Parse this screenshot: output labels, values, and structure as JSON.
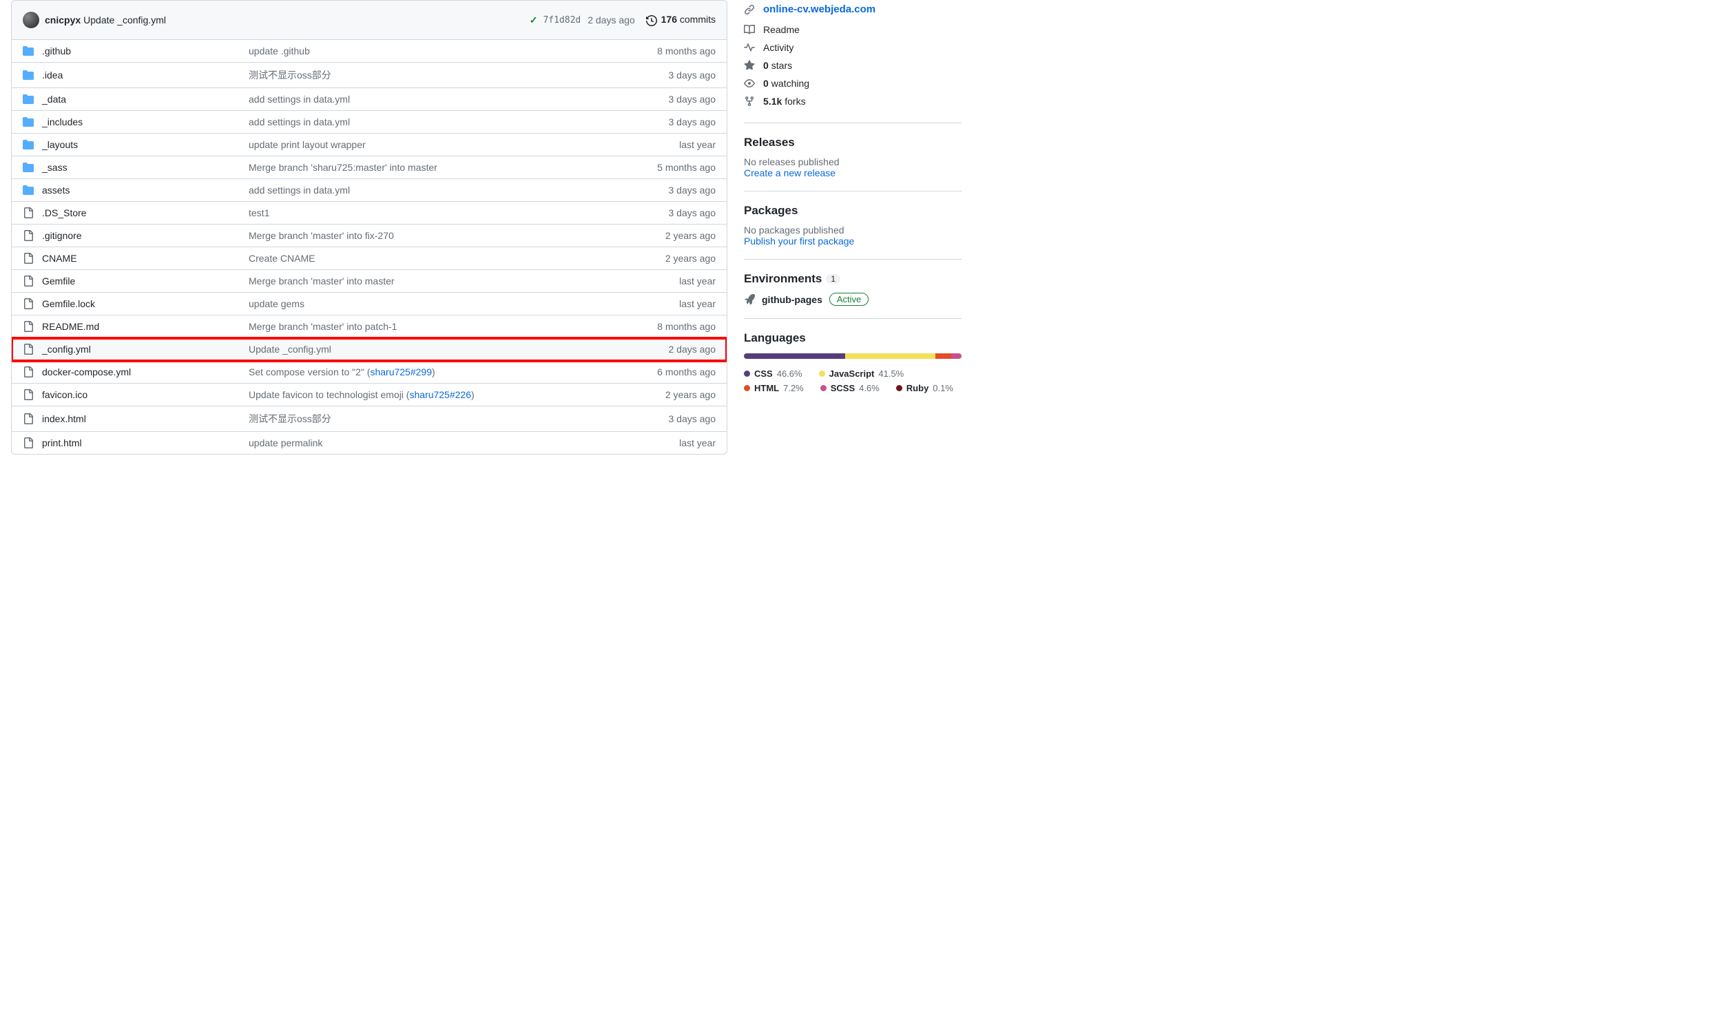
{
  "header": {
    "author": "cnicpyx",
    "commit_message": "Update _config.yml",
    "hash": "7f1d82d",
    "ago": "2 days ago",
    "commits_count": "176",
    "commits_label": "commits"
  },
  "files": [
    {
      "type": "folder",
      "name": ".github",
      "msg": "update .github",
      "ago": "8 months ago"
    },
    {
      "type": "folder",
      "name": ".idea",
      "msg": "测试不显示oss部分",
      "ago": "3 days ago"
    },
    {
      "type": "folder",
      "name": "_data",
      "msg": "add settings in data.yml",
      "ago": "3 days ago"
    },
    {
      "type": "folder",
      "name": "_includes",
      "msg": "add settings in data.yml",
      "ago": "3 days ago"
    },
    {
      "type": "folder",
      "name": "_layouts",
      "msg": "update print layout wrapper",
      "ago": "last year"
    },
    {
      "type": "folder",
      "name": "_sass",
      "msg": "Merge branch 'sharu725:master' into master",
      "ago": "5 months ago"
    },
    {
      "type": "folder",
      "name": "assets",
      "msg": "add settings in data.yml",
      "ago": "3 days ago"
    },
    {
      "type": "file",
      "name": ".DS_Store",
      "msg": "test1",
      "ago": "3 days ago"
    },
    {
      "type": "file",
      "name": ".gitignore",
      "msg": "Merge branch 'master' into fix-270",
      "ago": "2 years ago"
    },
    {
      "type": "file",
      "name": "CNAME",
      "msg": "Create CNAME",
      "ago": "2 years ago"
    },
    {
      "type": "file",
      "name": "Gemfile",
      "msg": "Merge branch 'master' into master",
      "ago": "last year"
    },
    {
      "type": "file",
      "name": "Gemfile.lock",
      "msg": "update gems",
      "ago": "last year"
    },
    {
      "type": "file",
      "name": "README.md",
      "msg": "Merge branch 'master' into patch-1",
      "ago": "8 months ago"
    },
    {
      "type": "file",
      "name": "_config.yml",
      "msg": "Update _config.yml",
      "ago": "2 days ago",
      "highlight": true
    },
    {
      "type": "file",
      "name": "docker-compose.yml",
      "msg_pre": "Set compose version to \"2\" (",
      "pr": "sharu725#299",
      "msg_post": ")",
      "ago": "6 months ago"
    },
    {
      "type": "file",
      "name": "favicon.ico",
      "msg_pre": "Update favicon to technologist emoji (",
      "pr": "sharu725#226",
      "msg_post": ")",
      "ago": "2 years ago"
    },
    {
      "type": "file",
      "name": "index.html",
      "msg": "测试不显示oss部分",
      "ago": "3 days ago"
    },
    {
      "type": "file",
      "name": "print.html",
      "msg": "update permalink",
      "ago": "last year"
    }
  ],
  "sidebar": {
    "website": "online-cv.webjeda.com",
    "readme": "Readme",
    "activity": "Activity",
    "stars_count": "0",
    "stars_label": "stars",
    "watch_count": "0",
    "watch_label": "watching",
    "forks_count": "5.1k",
    "forks_label": "forks",
    "releases": {
      "heading": "Releases",
      "none": "No releases published",
      "link": "Create a new release"
    },
    "packages": {
      "heading": "Packages",
      "none": "No packages published",
      "link": "Publish your first package"
    },
    "environments": {
      "heading": "Environments",
      "count": "1",
      "name": "github-pages",
      "status": "Active"
    },
    "languages": {
      "heading": "Languages",
      "items": [
        {
          "name": "CSS",
          "pct": "46.6%",
          "color": "#563d7c",
          "width": 46.6
        },
        {
          "name": "JavaScript",
          "pct": "41.5%",
          "color": "#f1e05a",
          "width": 41.5
        },
        {
          "name": "HTML",
          "pct": "7.2%",
          "color": "#e34c26",
          "width": 7.2
        },
        {
          "name": "SCSS",
          "pct": "4.6%",
          "color": "#c6538c",
          "width": 4.6
        },
        {
          "name": "Ruby",
          "pct": "0.1%",
          "color": "#701516",
          "width": 0.1
        }
      ]
    }
  }
}
